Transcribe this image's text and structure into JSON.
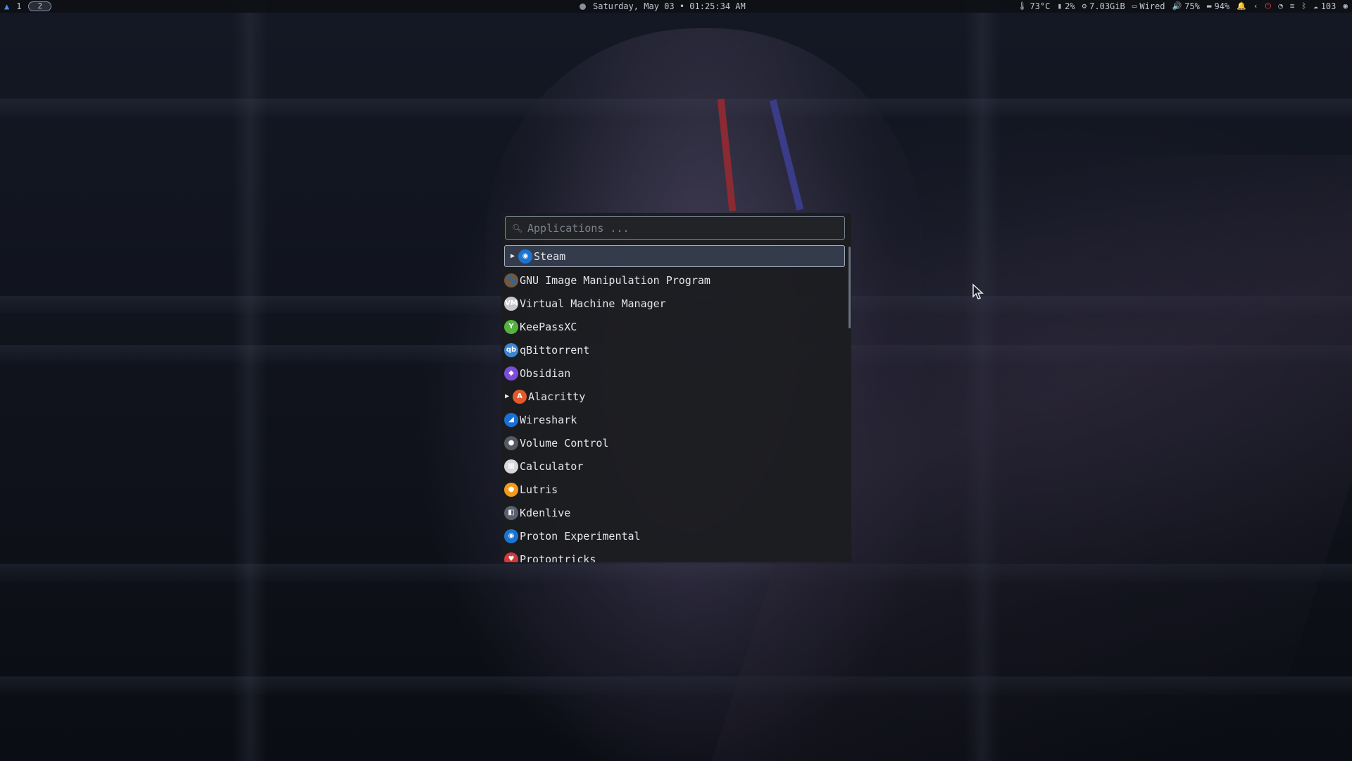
{
  "topbar": {
    "workspaces": [
      "1",
      "2"
    ],
    "active_workspace": "2",
    "datetime": "Saturday, May 03 • 01:25:34 AM",
    "status": [
      {
        "icon": "thermometer-icon",
        "text": "73°C"
      },
      {
        "icon": "cpu-icon",
        "text": "2%"
      },
      {
        "icon": "memory-icon",
        "text": "7.03GiB"
      },
      {
        "icon": "network-icon",
        "text": "Wired"
      },
      {
        "icon": "volume-icon",
        "text": "75%"
      },
      {
        "icon": "battery-icon",
        "text": "94%"
      }
    ],
    "tray_count": "103"
  },
  "launcher": {
    "placeholder": "Applications ...",
    "items": [
      {
        "label": "Steam",
        "icon": "steam-icon",
        "expandable": true,
        "selected": true,
        "color": "#1b75d0"
      },
      {
        "label": "GNU Image Manipulation Program",
        "icon": "gimp-icon",
        "expandable": false,
        "color": "#6b5a44"
      },
      {
        "label": "Virtual Machine Manager",
        "icon": "virt-manager-icon",
        "expandable": false,
        "color": "#c9c9c9"
      },
      {
        "label": "KeePassXC",
        "icon": "keepassxc-icon",
        "expandable": false,
        "color": "#56b141"
      },
      {
        "label": "qBittorrent",
        "icon": "qbittorrent-icon",
        "expandable": false,
        "color": "#3d85d6"
      },
      {
        "label": "Obsidian",
        "icon": "obsidian-icon",
        "expandable": false,
        "color": "#7c4ddb"
      },
      {
        "label": "Alacritty",
        "icon": "alacritty-icon",
        "expandable": true,
        "color": "#e05a2a"
      },
      {
        "label": "Wireshark",
        "icon": "wireshark-icon",
        "expandable": false,
        "color": "#1a6fd6"
      },
      {
        "label": "Volume Control",
        "icon": "volume-control-icon",
        "expandable": false,
        "color": "#555a63"
      },
      {
        "label": "Calculator",
        "icon": "calculator-icon",
        "expandable": false,
        "color": "#d8d8d8"
      },
      {
        "label": "Lutris",
        "icon": "lutris-icon",
        "expandable": false,
        "color": "#f29b1c"
      },
      {
        "label": "Kdenlive",
        "icon": "kdenlive-icon",
        "expandable": false,
        "color": "#5a6070"
      },
      {
        "label": "Proton Experimental",
        "icon": "proton-icon",
        "expandable": false,
        "color": "#1b75d0"
      },
      {
        "label": "Protontricks",
        "icon": "protontricks-icon",
        "expandable": false,
        "color": "#d03a3a"
      }
    ]
  }
}
